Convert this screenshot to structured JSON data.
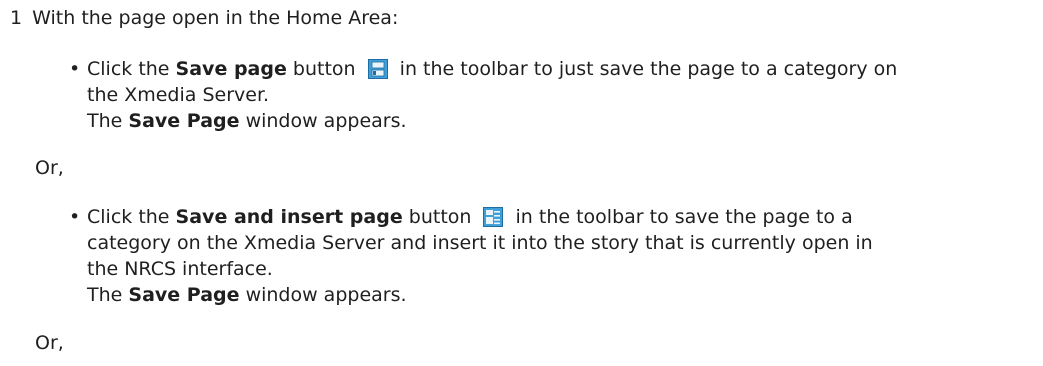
{
  "step": {
    "number": "1",
    "text": "With the page open in the Home Area:"
  },
  "bullet_char": "•",
  "items": [
    {
      "pre": "Click the",
      "bold": "Save page",
      "mid": "button",
      "icon": "save-page-icon",
      "post_line1": "in the toolbar to just save the page to a category on",
      "post_line2": "the Xmedia Server.",
      "result_bold": "Save Page",
      "result_text": "window appears."
    },
    {
      "pre": "Click the",
      "bold": "Save and insert page",
      "mid": "button",
      "icon": "save-and-insert-page-icon",
      "post_line1": "in the toolbar to save the page to a",
      "post_line2": "category on the Xmedia Server and insert it into the story that is currently open in",
      "post_line3": "the NRCS interface.",
      "result_bold": "Save Page",
      "result_text": "window appears."
    }
  ],
  "result_prefix": "The",
  "or_text": "Or,",
  "colors": {
    "icon_blue": "#3f9fd6",
    "icon_border": "#1f6ea3"
  }
}
